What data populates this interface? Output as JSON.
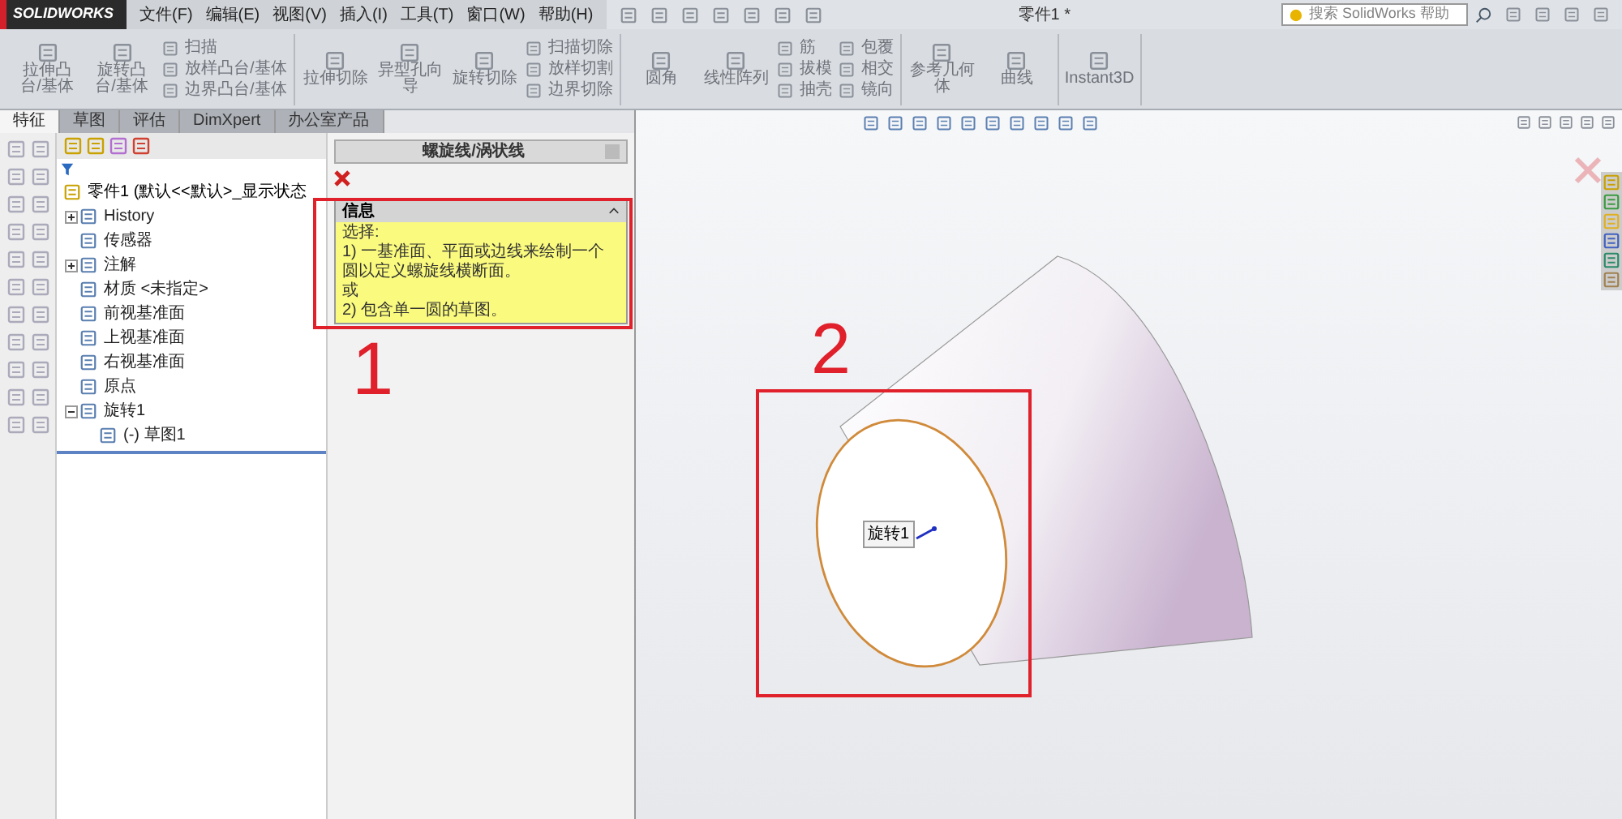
{
  "title_bar": {
    "logo": "SOLIDWORKS",
    "menus": [
      "文件(F)",
      "编辑(E)",
      "视图(V)",
      "插入(I)",
      "工具(T)",
      "窗口(W)",
      "帮助(H)"
    ],
    "document_title": "零件1 *",
    "search": {
      "placeholder": "搜索 SolidWorks 帮助"
    }
  },
  "ribbon": {
    "groups": [
      {
        "items": [
          {
            "kind": "large",
            "label": "拉伸凸台/基体"
          },
          {
            "kind": "large",
            "label": "旋转凸台/基体"
          },
          {
            "kind": "small",
            "label": "扫描"
          },
          {
            "kind": "small",
            "label": "放样凸台/基体"
          },
          {
            "kind": "small",
            "label": "边界凸台/基体"
          }
        ]
      },
      {
        "items": [
          {
            "kind": "large",
            "label": "拉伸切除"
          },
          {
            "kind": "large",
            "label": "异型孔向导"
          },
          {
            "kind": "large",
            "label": "旋转切除"
          },
          {
            "kind": "small",
            "label": "扫描切除"
          },
          {
            "kind": "small",
            "label": "放样切割"
          },
          {
            "kind": "small",
            "label": "边界切除"
          }
        ]
      },
      {
        "items": [
          {
            "kind": "large",
            "label": "圆角"
          },
          {
            "kind": "large",
            "label": "线性阵列"
          },
          {
            "kind": "small",
            "label": "筋"
          },
          {
            "kind": "small",
            "label": "拔模"
          },
          {
            "kind": "small",
            "label": "抽壳"
          },
          {
            "kind": "small",
            "label": "包覆"
          },
          {
            "kind": "small",
            "label": "相交"
          },
          {
            "kind": "small",
            "label": "镜向"
          }
        ]
      },
      {
        "items": [
          {
            "kind": "large",
            "label": "参考几何体"
          },
          {
            "kind": "large",
            "label": "曲线"
          }
        ]
      },
      {
        "items": [
          {
            "kind": "large",
            "label": "Instant3D"
          }
        ]
      }
    ]
  },
  "tabs": [
    {
      "label": "特征",
      "selected": true
    },
    {
      "label": "草图",
      "selected": false
    },
    {
      "label": "评估",
      "selected": false
    },
    {
      "label": "DimXpert",
      "selected": false
    },
    {
      "label": "办公室产品",
      "selected": false
    }
  ],
  "feature_tree": {
    "root": "零件1 (默认<<默认>_显示状态",
    "items": [
      {
        "label": "History",
        "expanded": false
      },
      {
        "label": "传感器"
      },
      {
        "label": "注解",
        "expanded": false
      },
      {
        "label": "材质 <未指定>"
      },
      {
        "label": "前视基准面"
      },
      {
        "label": "上视基准面"
      },
      {
        "label": "右视基准面"
      },
      {
        "label": "原点"
      },
      {
        "label": "旋转1",
        "expanded": true,
        "children": [
          {
            "label": "(-) 草图1"
          }
        ]
      }
    ]
  },
  "property_manager": {
    "title": "螺旋线/涡状线",
    "section": "信息",
    "message": [
      "选择:",
      "1) 一基准面、平面或边线来绘制一个圆以定义螺旋线横断面。",
      "或",
      "2) 包含单一圆的草图。"
    ]
  },
  "viewport": {
    "feature_label": "旋转1"
  },
  "annotations": [
    {
      "label": "1"
    },
    {
      "label": "2"
    }
  ]
}
